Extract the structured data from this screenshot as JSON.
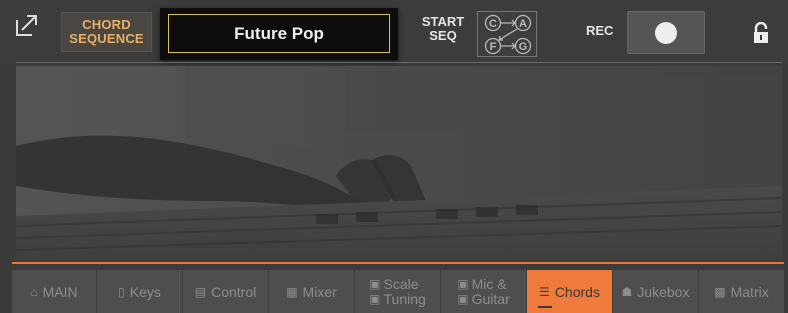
{
  "topbar": {
    "chord_sequence_line1": "CHORD",
    "chord_sequence_line2": "SEQUENCE",
    "style_name": "Future Pop",
    "start_seq_line1": "START",
    "start_seq_line2": "SEQ",
    "seq_letters": [
      "C",
      "A",
      "F",
      "G"
    ],
    "rec_label": "REC"
  },
  "tabs": [
    {
      "label": "MAIN",
      "icon": "home-icon"
    },
    {
      "label": "Keys",
      "icon": "keys-icon"
    },
    {
      "label": "Control",
      "icon": "control-icon"
    },
    {
      "label": "Mixer",
      "icon": "mixer-icon"
    },
    {
      "label_line1": "Scale",
      "label_line2": "Tuning",
      "icon": "scale-icon"
    },
    {
      "label_line1": "Mic &",
      "label_line2": "Guitar",
      "icon": "mic-icon"
    },
    {
      "label": "Chords",
      "icon": "chords-icon",
      "active": true
    },
    {
      "label": "Jukebox",
      "icon": "jukebox-icon"
    },
    {
      "label": "Matrix",
      "icon": "matrix-icon"
    }
  ],
  "colors": {
    "accent": "#ef7a3c",
    "chord_sequence_text": "#e9b063",
    "display_border": "#d9c15a"
  }
}
